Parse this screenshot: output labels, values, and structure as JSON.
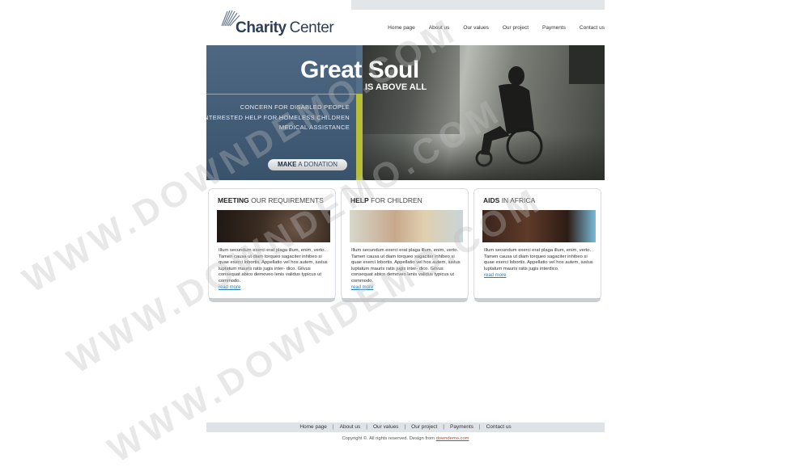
{
  "header": {
    "logo_bold": "Charity",
    "logo_light": "Center",
    "nav": [
      "Home page",
      "About us",
      "Our values",
      "Our project",
      "Payments",
      "Contact us"
    ]
  },
  "hero": {
    "headline": "Great Soul",
    "subheadline": "IS ABOVE ALL",
    "taglines": [
      "CONCERN FOR DISABLED PEOPLE",
      "DISINTERESTED HELP FOR HOMELESS CHILDREN",
      "MEDICAL ASSISTANCE"
    ],
    "donate_bold": "MAKE",
    "donate_light": "A DONATION",
    "accent_color": "#b8bd3a"
  },
  "columns": [
    {
      "title_bold": "MEETING",
      "title_light": "OUR REQUIREMENTS",
      "text": "Illum secundum exerci erat plaga illum, enim, verto. Tamen causa ut diam torqueo sagaciter inhibeo si quae exerci lobortis. Appellatio vel hos autem, iustus luptatum mauris ratis jugis inter- dico. Gilvus consequat abico demoveo lenis validus typicus ut commodo.",
      "link": "read more"
    },
    {
      "title_bold": "HELP",
      "title_light": "FOR CHILDREN",
      "text": "Illum secundum exerci erat plaga illum, enim, verto. Tamen causa ut diam torqueo sagaciter inhibeo si quae exerci lobortis. Appellatio vel hos autem, iustus luptatum mauris ratis jugis inter- dico. Gilvus consequat abico demoveo lenis validus typicus ut commodo.",
      "link": "read more"
    },
    {
      "title_bold": "AIDS",
      "title_light": "IN AFRICA",
      "text": "Illum secundum exerci erat plaga illum, enim, verto. Tamen causa ut diam torqueo sagaciter inhibeo si quae exerci lobortis. Appellatio vel hos autem, iustus luptatum mauris ratis jugis interdico.",
      "link": "read more"
    }
  ],
  "footer": {
    "nav": [
      "Home page",
      "About us",
      "Our values",
      "Our project",
      "Payments",
      "Contact us"
    ],
    "copyright_text": "Copyright ©. All rights reserved. Design from",
    "copyright_link": "downdemo.com"
  },
  "watermark": "WWW.DOWNDEMO.COM"
}
